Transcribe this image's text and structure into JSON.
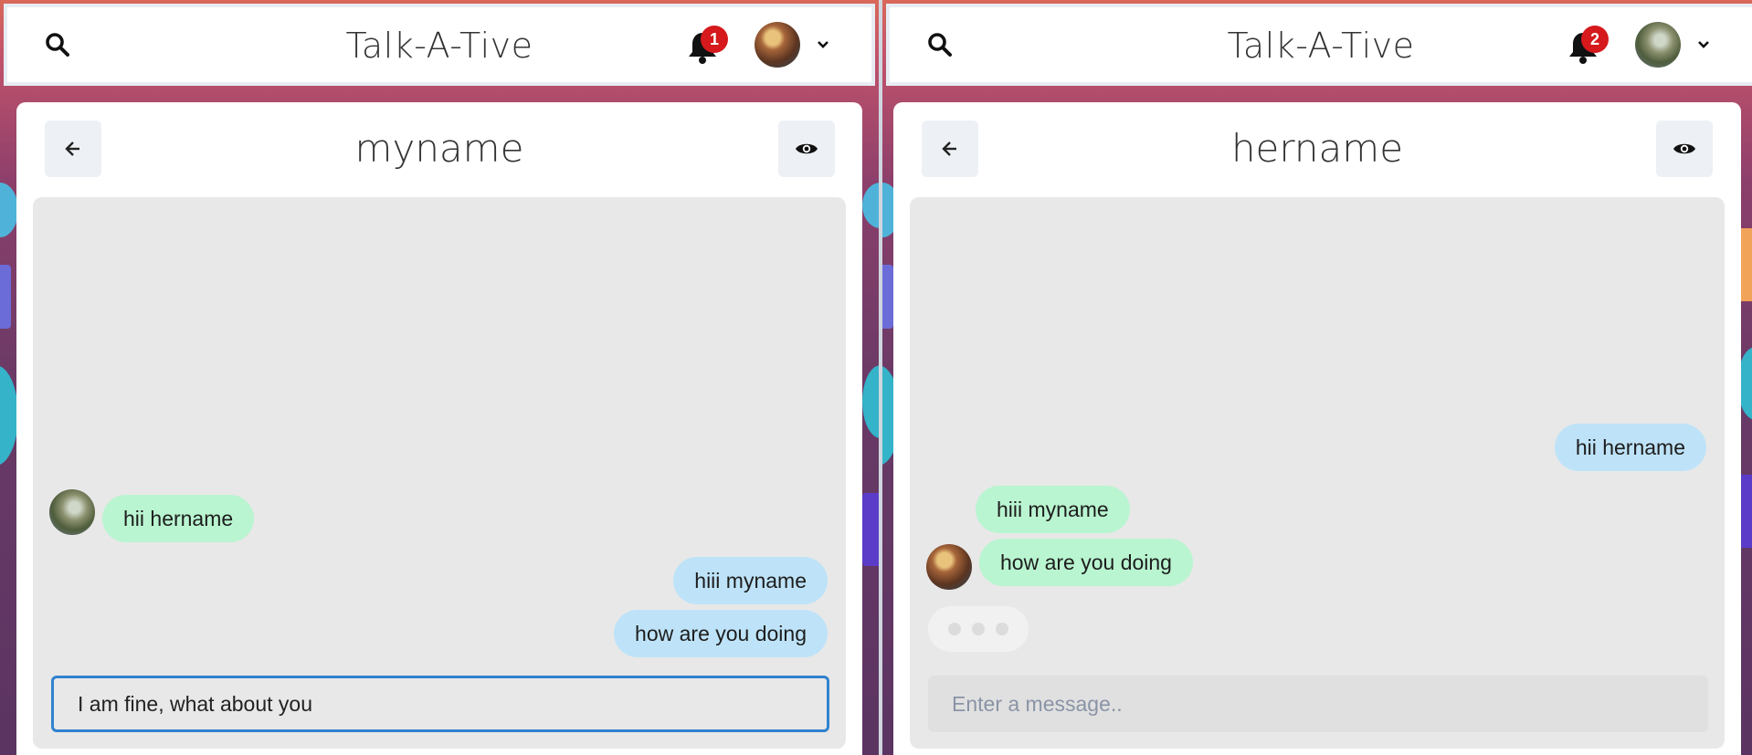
{
  "app": {
    "title": "Talk-A-Tive"
  },
  "left": {
    "notification_count": "1",
    "chat_title": "myname",
    "messages": [
      {
        "text": "hii hername",
        "side": "recv"
      },
      {
        "text": "hiii myname",
        "side": "sent"
      },
      {
        "text": "how are you doing",
        "side": "sent"
      }
    ],
    "input_value": "I am fine, what about you"
  },
  "right": {
    "notification_count": "2",
    "chat_title": "hername",
    "messages": [
      {
        "text": "hii hername",
        "side": "sent"
      },
      {
        "text": "hiii myname",
        "side": "recv"
      },
      {
        "text": "how are you doing",
        "side": "recv"
      }
    ],
    "input_placeholder": "Enter a message.."
  },
  "colors": {
    "sent_bubble": "#bee3f8",
    "recv_bubble": "#b9f5d0",
    "badge": "#d5191c",
    "input_focus": "#3182ce"
  },
  "icons": [
    "search-icon",
    "bell-icon",
    "chevron-down-icon",
    "arrow-left-icon",
    "eye-icon"
  ]
}
